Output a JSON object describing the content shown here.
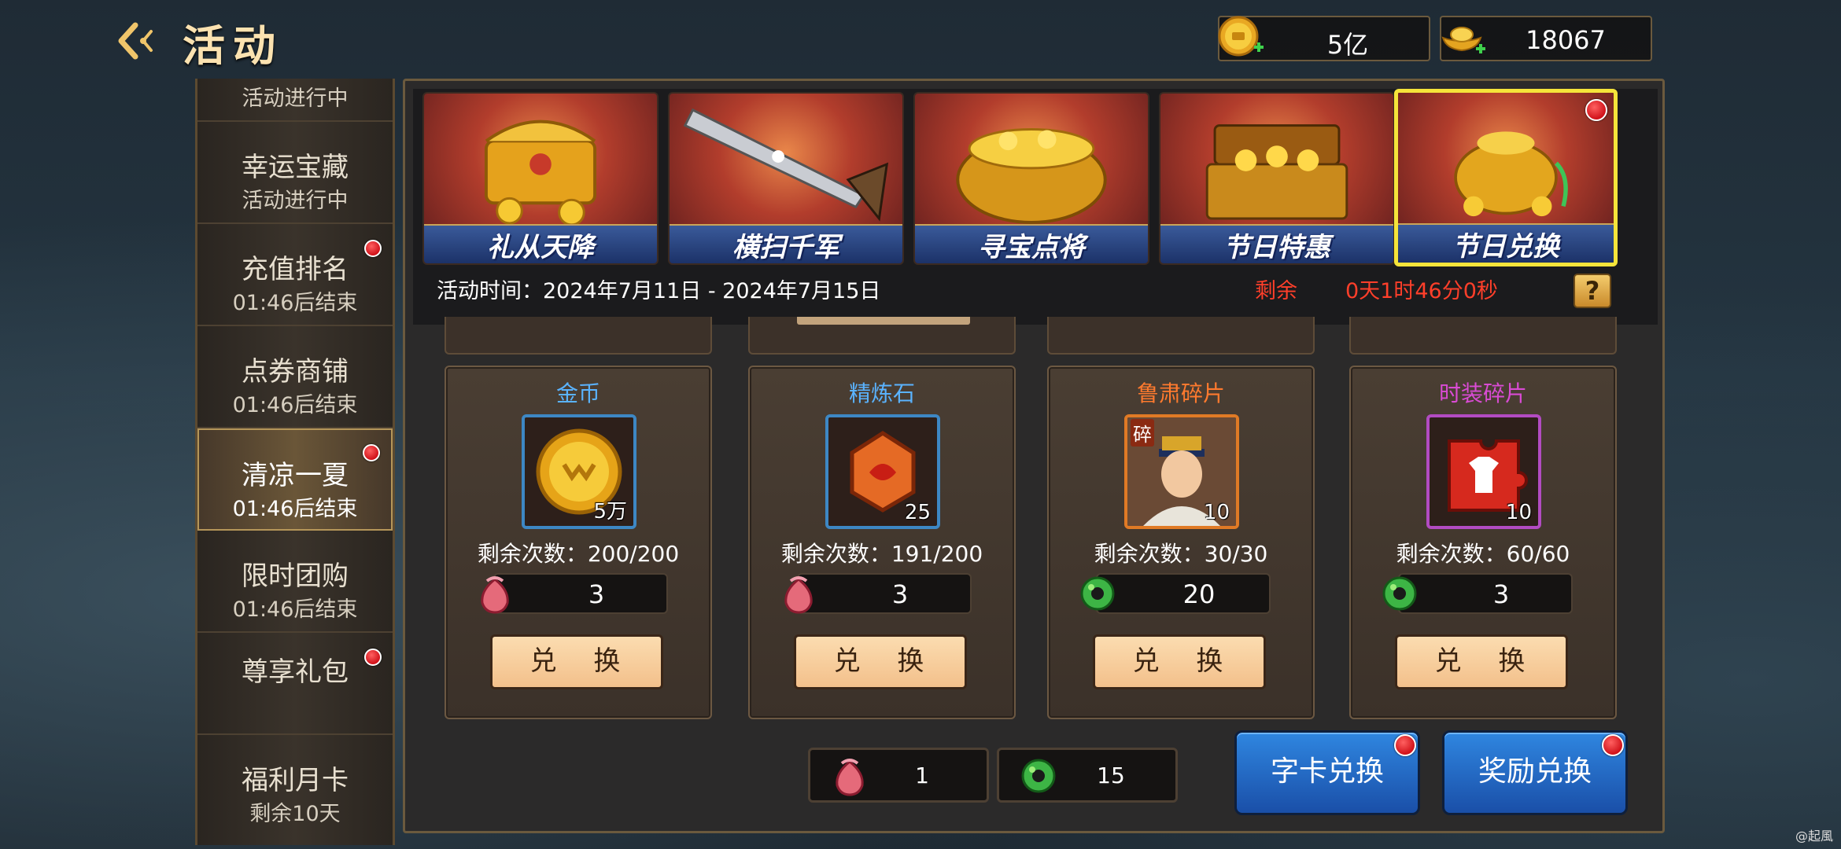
{
  "header": {
    "title": "活动",
    "currencies": [
      {
        "icon": "gold-coin-icon",
        "value": "5亿"
      },
      {
        "icon": "gold-ingot-icon",
        "value": "18067"
      }
    ]
  },
  "sidebar": {
    "items": [
      {
        "name": "",
        "status": "活动进行中",
        "dot": false
      },
      {
        "name": "幸运宝藏",
        "status": "活动进行中",
        "dot": false
      },
      {
        "name": "充值排名",
        "status": "01:46后结束",
        "dot": true
      },
      {
        "name": "点券商铺",
        "status": "01:46后结束",
        "dot": false
      },
      {
        "name": "清凉一夏",
        "status": "01:46后结束",
        "dot": true,
        "active": true
      },
      {
        "name": "限时团购",
        "status": "01:46后结束",
        "dot": false
      },
      {
        "name": "尊享礼包",
        "status": "",
        "dot": true
      },
      {
        "name": "福利月卡",
        "status": "剩余10天",
        "dot": false
      }
    ]
  },
  "tabs": [
    {
      "label": "礼从天降",
      "icon": "treasure-chest-icon"
    },
    {
      "label": "横扫千军",
      "icon": "sword-icon"
    },
    {
      "label": "寻宝点将",
      "icon": "treasure-pot-icon"
    },
    {
      "label": "节日特惠",
      "icon": "gold-chest-icon"
    },
    {
      "label": "节日兑换",
      "icon": "gold-bag-icon",
      "selected": true,
      "dot": true
    }
  ],
  "event": {
    "time_label": "活动时间：",
    "time_range": "2024年7月11日 - 2024年7月15日",
    "remain_label": "剩余",
    "remain_value": "0天1时46分0秒"
  },
  "cards": [
    {
      "title": "金币",
      "title_color": "#5ab3ff",
      "frame_color": "#3d87c4",
      "qty": "5万",
      "remaining": "剩余次数：200/200",
      "cost": "3",
      "cost_icon": "red-pouch-icon",
      "button": "兑 换"
    },
    {
      "title": "精炼石",
      "title_color": "#5ab3ff",
      "frame_color": "#3d87c4",
      "qty": "25",
      "remaining": "剩余次数：191/200",
      "cost": "3",
      "cost_icon": "red-pouch-icon",
      "button": "兑 换"
    },
    {
      "title": "鲁肃碎片",
      "title_color": "#ff7a2e",
      "frame_color": "#e07a25",
      "qty": "10",
      "badge": "碎",
      "remaining": "剩余次数：30/30",
      "cost": "20",
      "cost_icon": "green-jade-icon",
      "button": "兑 换"
    },
    {
      "title": "时装碎片",
      "title_color": "#d94bd4",
      "frame_color": "#b24bc2",
      "qty": "10",
      "remaining": "剩余次数：60/60",
      "cost": "3",
      "cost_icon": "green-jade-icon",
      "button": "兑 换"
    }
  ],
  "balances": [
    {
      "icon": "red-pouch-icon",
      "value": "1"
    },
    {
      "icon": "green-jade-icon",
      "value": "15"
    }
  ],
  "buttons": {
    "card_exchange": "字卡兑换",
    "reward_exchange": "奖励兑换"
  },
  "watermark": "@起風"
}
